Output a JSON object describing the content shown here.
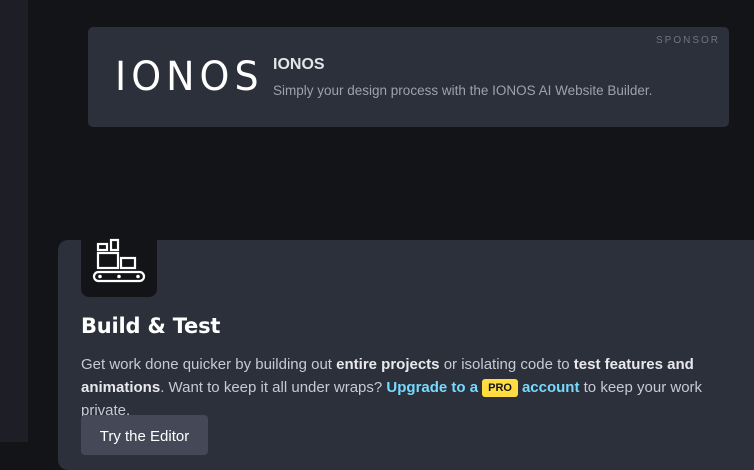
{
  "sponsor": {
    "badge": "SPONSOR",
    "logo_text": "IONOS",
    "title": "IONOS",
    "description": "Simply your design process with the IONOS AI Website Builder."
  },
  "feature": {
    "icon": "conveyor-boxes-icon",
    "title": "Build & Test",
    "text_1": "Get work done quicker by building out ",
    "bold_1": "entire projects",
    "text_2": " or isolating code to ",
    "bold_2": "test features and animations",
    "text_3": ". Want to keep it all under wraps? ",
    "link_1": "Upgrade to a",
    "pro_badge": "PRO",
    "link_2": "account",
    "text_4": " to keep your work private.",
    "button_label": "Try the Editor"
  },
  "colors": {
    "background": "#131417",
    "card": "#2c303a",
    "link": "#76daff",
    "pro_badge": "#ffdd40",
    "button": "#444857"
  }
}
